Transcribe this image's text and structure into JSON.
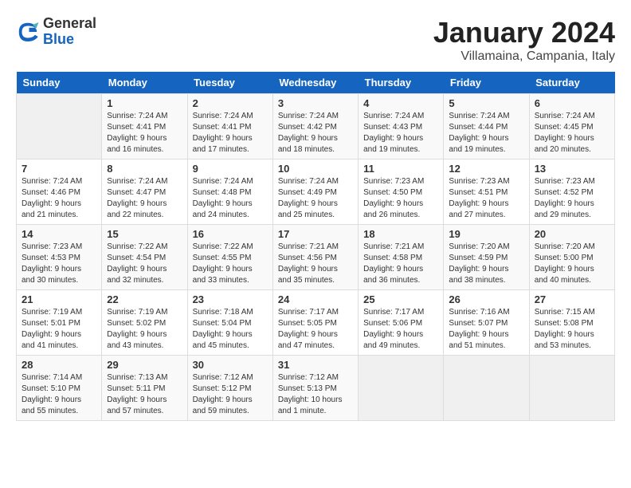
{
  "header": {
    "logo_general": "General",
    "logo_blue": "Blue",
    "month_title": "January 2024",
    "location": "Villamaina, Campania, Italy"
  },
  "days_of_week": [
    "Sunday",
    "Monday",
    "Tuesday",
    "Wednesday",
    "Thursday",
    "Friday",
    "Saturday"
  ],
  "weeks": [
    [
      {
        "day": "",
        "sunrise": "",
        "sunset": "",
        "daylight": ""
      },
      {
        "day": "1",
        "sunrise": "Sunrise: 7:24 AM",
        "sunset": "Sunset: 4:41 PM",
        "daylight": "Daylight: 9 hours and 16 minutes."
      },
      {
        "day": "2",
        "sunrise": "Sunrise: 7:24 AM",
        "sunset": "Sunset: 4:41 PM",
        "daylight": "Daylight: 9 hours and 17 minutes."
      },
      {
        "day": "3",
        "sunrise": "Sunrise: 7:24 AM",
        "sunset": "Sunset: 4:42 PM",
        "daylight": "Daylight: 9 hours and 18 minutes."
      },
      {
        "day": "4",
        "sunrise": "Sunrise: 7:24 AM",
        "sunset": "Sunset: 4:43 PM",
        "daylight": "Daylight: 9 hours and 19 minutes."
      },
      {
        "day": "5",
        "sunrise": "Sunrise: 7:24 AM",
        "sunset": "Sunset: 4:44 PM",
        "daylight": "Daylight: 9 hours and 19 minutes."
      },
      {
        "day": "6",
        "sunrise": "Sunrise: 7:24 AM",
        "sunset": "Sunset: 4:45 PM",
        "daylight": "Daylight: 9 hours and 20 minutes."
      }
    ],
    [
      {
        "day": "7",
        "sunrise": "Sunrise: 7:24 AM",
        "sunset": "Sunset: 4:46 PM",
        "daylight": "Daylight: 9 hours and 21 minutes."
      },
      {
        "day": "8",
        "sunrise": "Sunrise: 7:24 AM",
        "sunset": "Sunset: 4:47 PM",
        "daylight": "Daylight: 9 hours and 22 minutes."
      },
      {
        "day": "9",
        "sunrise": "Sunrise: 7:24 AM",
        "sunset": "Sunset: 4:48 PM",
        "daylight": "Daylight: 9 hours and 24 minutes."
      },
      {
        "day": "10",
        "sunrise": "Sunrise: 7:24 AM",
        "sunset": "Sunset: 4:49 PM",
        "daylight": "Daylight: 9 hours and 25 minutes."
      },
      {
        "day": "11",
        "sunrise": "Sunrise: 7:23 AM",
        "sunset": "Sunset: 4:50 PM",
        "daylight": "Daylight: 9 hours and 26 minutes."
      },
      {
        "day": "12",
        "sunrise": "Sunrise: 7:23 AM",
        "sunset": "Sunset: 4:51 PM",
        "daylight": "Daylight: 9 hours and 27 minutes."
      },
      {
        "day": "13",
        "sunrise": "Sunrise: 7:23 AM",
        "sunset": "Sunset: 4:52 PM",
        "daylight": "Daylight: 9 hours and 29 minutes."
      }
    ],
    [
      {
        "day": "14",
        "sunrise": "Sunrise: 7:23 AM",
        "sunset": "Sunset: 4:53 PM",
        "daylight": "Daylight: 9 hours and 30 minutes."
      },
      {
        "day": "15",
        "sunrise": "Sunrise: 7:22 AM",
        "sunset": "Sunset: 4:54 PM",
        "daylight": "Daylight: 9 hours and 32 minutes."
      },
      {
        "day": "16",
        "sunrise": "Sunrise: 7:22 AM",
        "sunset": "Sunset: 4:55 PM",
        "daylight": "Daylight: 9 hours and 33 minutes."
      },
      {
        "day": "17",
        "sunrise": "Sunrise: 7:21 AM",
        "sunset": "Sunset: 4:56 PM",
        "daylight": "Daylight: 9 hours and 35 minutes."
      },
      {
        "day": "18",
        "sunrise": "Sunrise: 7:21 AM",
        "sunset": "Sunset: 4:58 PM",
        "daylight": "Daylight: 9 hours and 36 minutes."
      },
      {
        "day": "19",
        "sunrise": "Sunrise: 7:20 AM",
        "sunset": "Sunset: 4:59 PM",
        "daylight": "Daylight: 9 hours and 38 minutes."
      },
      {
        "day": "20",
        "sunrise": "Sunrise: 7:20 AM",
        "sunset": "Sunset: 5:00 PM",
        "daylight": "Daylight: 9 hours and 40 minutes."
      }
    ],
    [
      {
        "day": "21",
        "sunrise": "Sunrise: 7:19 AM",
        "sunset": "Sunset: 5:01 PM",
        "daylight": "Daylight: 9 hours and 41 minutes."
      },
      {
        "day": "22",
        "sunrise": "Sunrise: 7:19 AM",
        "sunset": "Sunset: 5:02 PM",
        "daylight": "Daylight: 9 hours and 43 minutes."
      },
      {
        "day": "23",
        "sunrise": "Sunrise: 7:18 AM",
        "sunset": "Sunset: 5:04 PM",
        "daylight": "Daylight: 9 hours and 45 minutes."
      },
      {
        "day": "24",
        "sunrise": "Sunrise: 7:17 AM",
        "sunset": "Sunset: 5:05 PM",
        "daylight": "Daylight: 9 hours and 47 minutes."
      },
      {
        "day": "25",
        "sunrise": "Sunrise: 7:17 AM",
        "sunset": "Sunset: 5:06 PM",
        "daylight": "Daylight: 9 hours and 49 minutes."
      },
      {
        "day": "26",
        "sunrise": "Sunrise: 7:16 AM",
        "sunset": "Sunset: 5:07 PM",
        "daylight": "Daylight: 9 hours and 51 minutes."
      },
      {
        "day": "27",
        "sunrise": "Sunrise: 7:15 AM",
        "sunset": "Sunset: 5:08 PM",
        "daylight": "Daylight: 9 hours and 53 minutes."
      }
    ],
    [
      {
        "day": "28",
        "sunrise": "Sunrise: 7:14 AM",
        "sunset": "Sunset: 5:10 PM",
        "daylight": "Daylight: 9 hours and 55 minutes."
      },
      {
        "day": "29",
        "sunrise": "Sunrise: 7:13 AM",
        "sunset": "Sunset: 5:11 PM",
        "daylight": "Daylight: 9 hours and 57 minutes."
      },
      {
        "day": "30",
        "sunrise": "Sunrise: 7:12 AM",
        "sunset": "Sunset: 5:12 PM",
        "daylight": "Daylight: 9 hours and 59 minutes."
      },
      {
        "day": "31",
        "sunrise": "Sunrise: 7:12 AM",
        "sunset": "Sunset: 5:13 PM",
        "daylight": "Daylight: 10 hours and 1 minute."
      },
      {
        "day": "",
        "sunrise": "",
        "sunset": "",
        "daylight": ""
      },
      {
        "day": "",
        "sunrise": "",
        "sunset": "",
        "daylight": ""
      },
      {
        "day": "",
        "sunrise": "",
        "sunset": "",
        "daylight": ""
      }
    ]
  ]
}
